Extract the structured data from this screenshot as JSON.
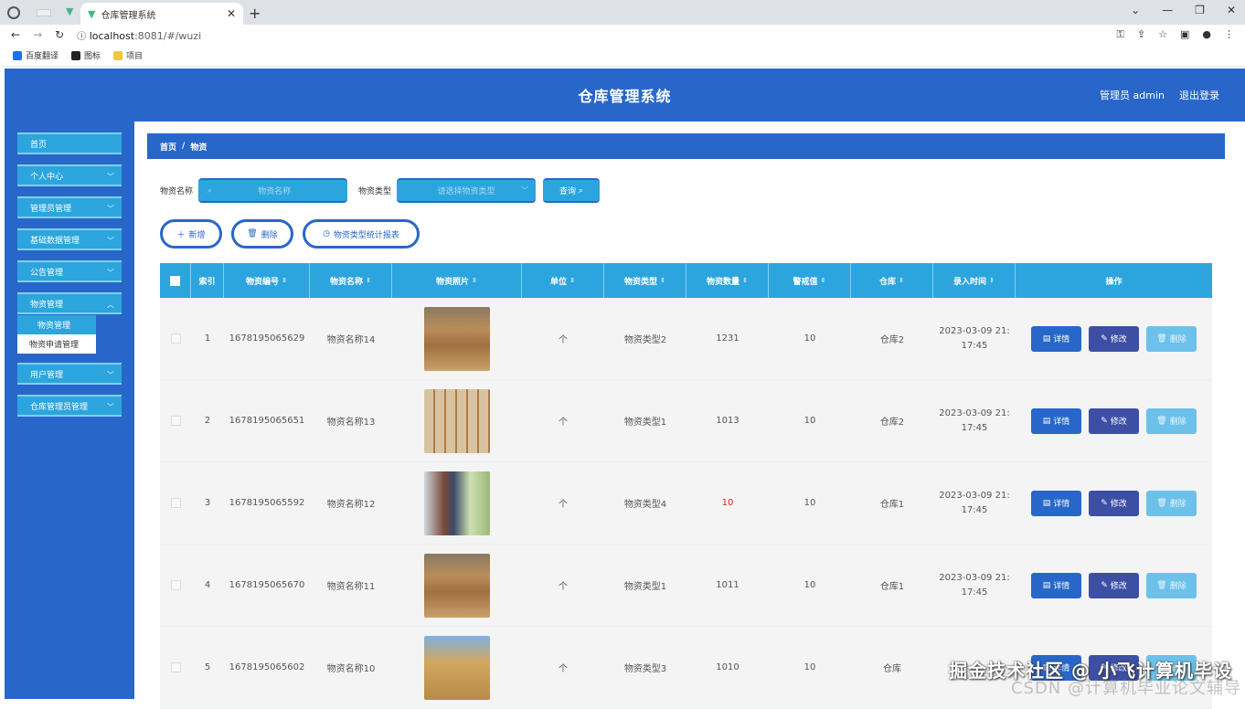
{
  "browser": {
    "tab_title": "仓库管理系统",
    "url_host": "localhost",
    "url_path": ":8081/#/wuzi",
    "bookmarks": [
      "百度翻译",
      "图标",
      "项目"
    ]
  },
  "header": {
    "title": "仓库管理系统",
    "user_label": "管理员 admin",
    "logout": "退出登录"
  },
  "sidebar": {
    "items": [
      {
        "label": "首页"
      },
      {
        "label": "个人中心"
      },
      {
        "label": "管理员管理"
      },
      {
        "label": "基础数据管理"
      },
      {
        "label": "公告管理"
      },
      {
        "label": "物资管理"
      }
    ],
    "submenu": [
      "物资管理",
      "物资申请管理"
    ],
    "items_after": [
      {
        "label": "用户管理"
      },
      {
        "label": "仓库管理员管理"
      }
    ]
  },
  "breadcrumb": {
    "home": "首页",
    "sep": "/",
    "current": "物资"
  },
  "search": {
    "name_label": "物资名称",
    "name_placeholder": "物资名称",
    "type_label": "物资类型",
    "type_placeholder": "请选择物资类型",
    "query_button": "查询"
  },
  "actions": {
    "add": "新增",
    "delete": "删除",
    "stats": "物资类型统计报表"
  },
  "table": {
    "headers": [
      "索引",
      "物资编号",
      "物资名称",
      "物资照片",
      "单位",
      "物资类型",
      "物资数量",
      "警戒值",
      "仓库",
      "录入时间",
      "操作"
    ],
    "rows": [
      {
        "index": "1",
        "code": "1678195065629",
        "name": "物资名称14",
        "unit": "个",
        "type": "物资类型2",
        "qty": "1231",
        "warn": "10",
        "warehouse": "仓库2",
        "time1": "2023-03-09 21:",
        "time2": "17:45",
        "low": false,
        "photo": "a"
      },
      {
        "index": "2",
        "code": "1678195065651",
        "name": "物资名称13",
        "unit": "个",
        "type": "物资类型1",
        "qty": "1013",
        "warn": "10",
        "warehouse": "仓库2",
        "time1": "2023-03-09 21:",
        "time2": "17:45",
        "low": false,
        "photo": "b"
      },
      {
        "index": "3",
        "code": "1678195065592",
        "name": "物资名称12",
        "unit": "个",
        "type": "物资类型4",
        "qty": "10",
        "warn": "10",
        "warehouse": "仓库1",
        "time1": "2023-03-09 21:",
        "time2": "17:45",
        "low": true,
        "photo": "c"
      },
      {
        "index": "4",
        "code": "1678195065670",
        "name": "物资名称11",
        "unit": "个",
        "type": "物资类型1",
        "qty": "1011",
        "warn": "10",
        "warehouse": "仓库1",
        "time1": "2023-03-09 21:",
        "time2": "17:45",
        "low": false,
        "photo": "a"
      },
      {
        "index": "5",
        "code": "1678195065602",
        "name": "物资名称10",
        "unit": "个",
        "type": "物资类型3",
        "qty": "1010",
        "warn": "10",
        "warehouse": "仓库",
        "time1": "",
        "time2": "",
        "low": false,
        "photo": "d"
      }
    ],
    "op_detail": "详情",
    "op_edit": "修改",
    "op_delete": "删除"
  },
  "watermark": {
    "line1": "掘金技术社区 @ 小飞计算机毕设",
    "line2": "CSDN @计算机毕业论文辅导"
  },
  "colors": {
    "primary": "#2867c9",
    "accent": "#2ca5de",
    "edit": "#3d4fa5",
    "alert": "#e02020"
  }
}
